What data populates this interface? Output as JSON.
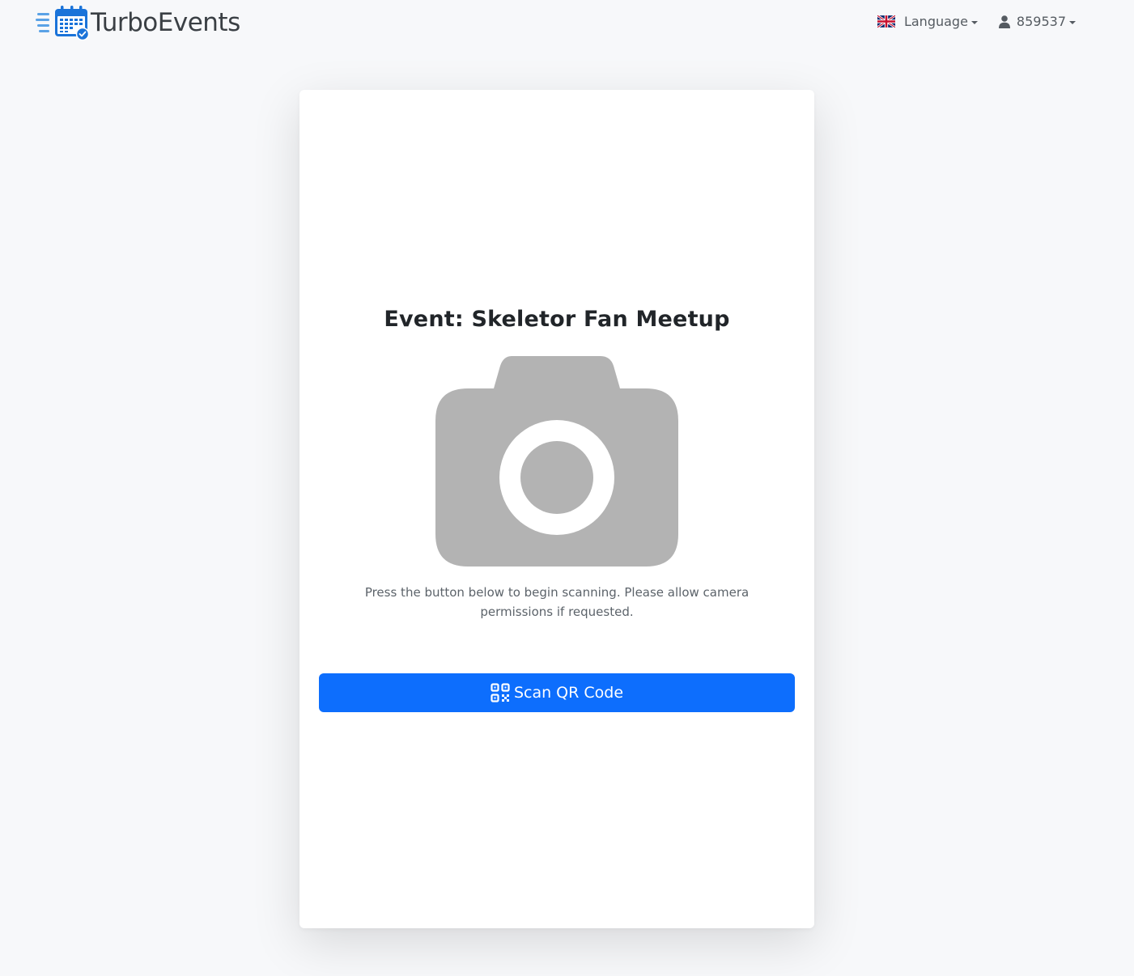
{
  "app": {
    "brand_name": "TurboEvents"
  },
  "nav": {
    "language_label": "Language",
    "user_label": "859537"
  },
  "card": {
    "event_title": "Event: Skeletor Fan Meetup",
    "instructions": "Press the button below to begin scanning. Please allow camera permissions if requested.",
    "scan_button_label": "Scan QR Code"
  },
  "icons": {
    "logo": "calendar-check-icon",
    "language": "uk-flag-icon",
    "user": "person-icon",
    "camera": "camera-icon",
    "scan": "qr-code-icon"
  },
  "colors": {
    "primary": "#0d6efd",
    "logo_blue": "#1a73d9",
    "camera_gray": "#b3b3b3",
    "background": "#f7f8fa"
  }
}
